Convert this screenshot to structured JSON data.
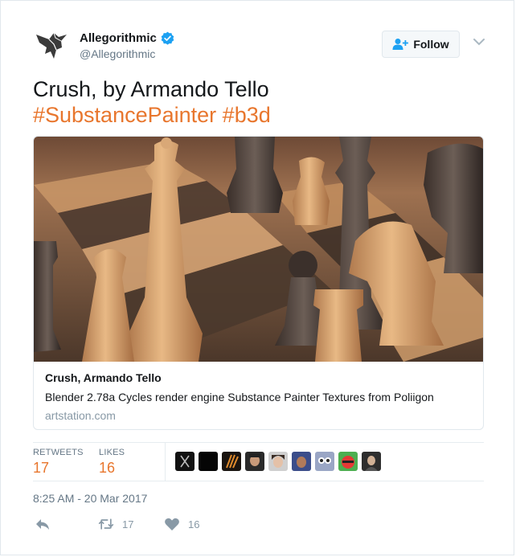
{
  "account": {
    "display_name": "Allegorithmic",
    "screen_name": "@Allegorithmic",
    "avatar_icon": "bird-logo-icon",
    "verified": true
  },
  "follow_button": {
    "label": "Follow",
    "icon": "add-user-icon"
  },
  "tweet": {
    "text_line": "Crush, by Armando Tello",
    "hashtags": [
      "#SubstancePainter",
      "#b3d"
    ]
  },
  "card": {
    "image_subject": "chess-pieces-on-board-render",
    "title": "Crush, Armando Tello",
    "description": "Blender 2.78a Cycles render engine Substance Painter Textures from Poliigon",
    "domain": "artstation.com"
  },
  "stats": {
    "retweets_label": "RETWEETS",
    "retweets_count": "17",
    "likes_label": "LIKES",
    "likes_count": "16",
    "liker_avatar_count": 9
  },
  "timestamp": "8:25 AM - 20 Mar 2017",
  "actions": {
    "reply_icon": "reply-icon",
    "retweet_count": "17",
    "like_count": "16"
  },
  "colors": {
    "accent_orange": "#e8762d",
    "verified_blue": "#1da1f2",
    "muted_gray": "#657786"
  }
}
